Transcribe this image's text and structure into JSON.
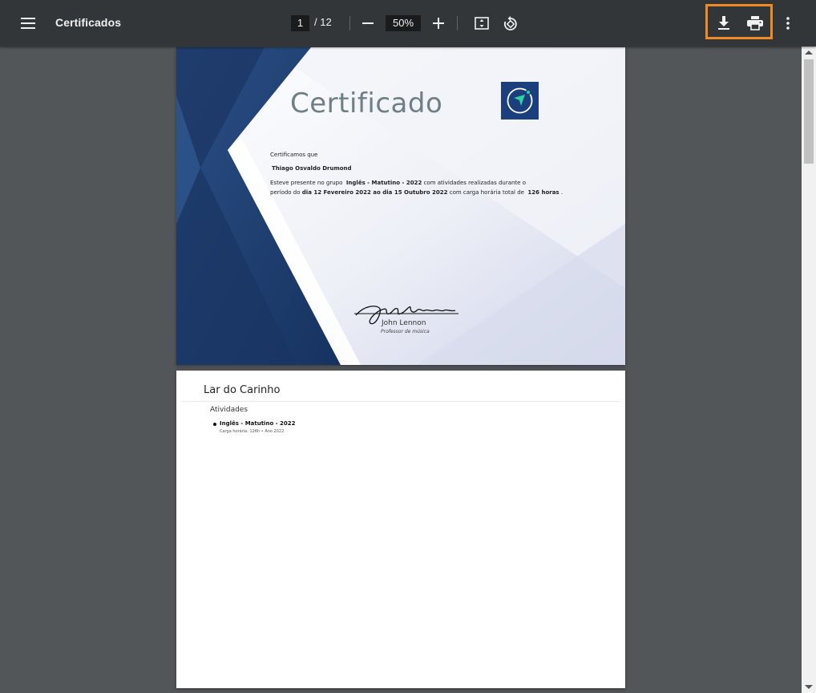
{
  "toolbar": {
    "title": "Certificados",
    "current_page": "1",
    "page_total": "/ 12",
    "zoom": "50%",
    "icons": {
      "menu": "hamburger-menu-icon",
      "zoom_out": "minus-icon",
      "zoom_in": "plus-icon",
      "fit": "fit-to-page-icon",
      "rotate": "rotate-counterclockwise-icon",
      "download": "download-icon",
      "print": "print-icon",
      "more": "more-vertical-icon"
    }
  },
  "certificate": {
    "title": "Certificado",
    "intro": "Certificamos que",
    "recipient": "Thiago Osvaldo Drumond",
    "line1_prefix": "Esteve presente no grupo",
    "group": "Inglês - Matutino - 2022",
    "line1_suffix": "com atividades realizadas durante o",
    "line2_prefix": "período do",
    "period": "dia 12 Fevereiro 2022 ao dia 15 Outubro 2022",
    "line2_middle": "com carga horária total de",
    "hours": "126 horas",
    "line2_end": ".",
    "signature_name": "John Lennon",
    "signature_role": "Professor de música"
  },
  "page2": {
    "org": "Lar do Carinho",
    "activities_heading": "Atividades",
    "activity": "Inglês - Matutino - 2022",
    "activity_meta": "Carga horária: 126h • Ano 2022"
  },
  "colors": {
    "toolbar_bg": "#323639",
    "viewer_bg": "#525659",
    "highlight": "#f08a24",
    "navy": "#1b3f7d"
  }
}
